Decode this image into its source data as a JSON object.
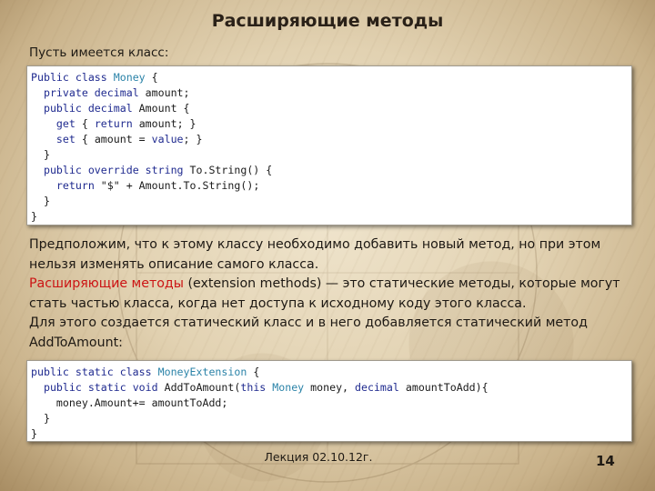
{
  "slide": {
    "title": "Расширяющие методы",
    "intro": "Пусть имеется класс:",
    "code1": [
      [
        {
          "t": "Public class ",
          "k": "kw"
        },
        {
          "t": "Money",
          "k": "ty"
        },
        {
          "t": " {"
        }
      ],
      [
        {
          "t": "  "
        },
        {
          "t": "private decimal",
          "k": "kw"
        },
        {
          "t": " amount;"
        }
      ],
      [
        {
          "t": "  "
        },
        {
          "t": "public decimal",
          "k": "kw"
        },
        {
          "t": " Amount {"
        }
      ],
      [
        {
          "t": "    "
        },
        {
          "t": "get",
          "k": "kw"
        },
        {
          "t": " { "
        },
        {
          "t": "return",
          "k": "kw"
        },
        {
          "t": " amount; }"
        }
      ],
      [
        {
          "t": "    "
        },
        {
          "t": "set",
          "k": "kw"
        },
        {
          "t": " { amount = "
        },
        {
          "t": "value",
          "k": "kw"
        },
        {
          "t": "; }"
        }
      ],
      [
        {
          "t": "  }"
        }
      ],
      [
        {
          "t": "  "
        },
        {
          "t": "public override string",
          "k": "kw"
        },
        {
          "t": " To.String() {"
        }
      ],
      [
        {
          "t": "    "
        },
        {
          "t": "return",
          "k": "kw"
        },
        {
          "t": " \"$\" + Amount.To.String();"
        }
      ],
      [
        {
          "t": "  }"
        }
      ],
      [
        {
          "t": "}"
        }
      ]
    ],
    "para": {
      "p1": "Предположим, что к этому классу необходимо добавить новый метод, но при этом нельзя изменять описание самого класса.",
      "p2_red": "Расширяющие методы",
      "p2_rest": " (extension methods) — это статические методы, которые могут стать частью класса, когда нет доступа к исходному коду этого класса.",
      "p3": "Для этого создается статический класс и в него добавляется статический метод AddToAmount:"
    },
    "code2": [
      [
        {
          "t": "public static class ",
          "k": "kw"
        },
        {
          "t": "MoneyExtension",
          "k": "ty"
        },
        {
          "t": " {"
        }
      ],
      [
        {
          "t": "  "
        },
        {
          "t": "public static void",
          "k": "kw"
        },
        {
          "t": " AddToAmount("
        },
        {
          "t": "this",
          "k": "kw"
        },
        {
          "t": " "
        },
        {
          "t": "Money",
          "k": "ty"
        },
        {
          "t": " money, "
        },
        {
          "t": "decimal",
          "k": "kw"
        },
        {
          "t": " amountToAdd){"
        }
      ],
      [
        {
          "t": "    money.Amount+= amountToAdd;"
        }
      ],
      [
        {
          "t": "  }"
        }
      ],
      [
        {
          "t": "}"
        }
      ]
    ],
    "footer": "Лекция 02.10.12г.",
    "page_number": "14"
  }
}
